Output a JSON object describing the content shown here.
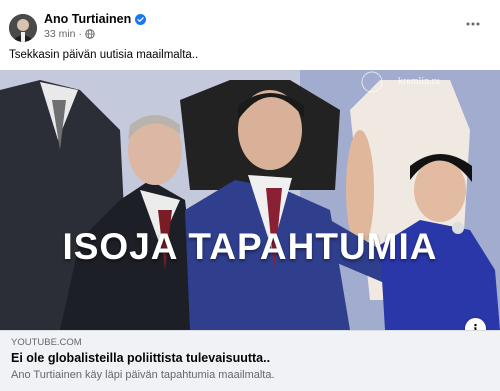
{
  "post": {
    "author": "Ano Turtiainen",
    "timestamp": "33 min",
    "separator": "·",
    "caption": "Tsekkasin päivän uutisia maailmalta..",
    "verified_icon": "verified-badge-icon",
    "audience_icon": "globe-icon",
    "more_icon": "more-options-icon"
  },
  "media": {
    "overlay_text": "ISOJA TAPAHTUMIA",
    "watermark": "kremlin.ru",
    "info_icon": "info-icon"
  },
  "link_preview": {
    "domain": "YOUTUBE.COM",
    "title": "Ei ole globalisteilla poliittista tulevaisuutta..",
    "description": "Ano Turtiainen käy läpi päivän tapahtumia maailmalta."
  },
  "colors": {
    "verified_blue": "#1877f2",
    "secondary_text": "#65676b",
    "footer_bg": "#f0f2f5"
  }
}
